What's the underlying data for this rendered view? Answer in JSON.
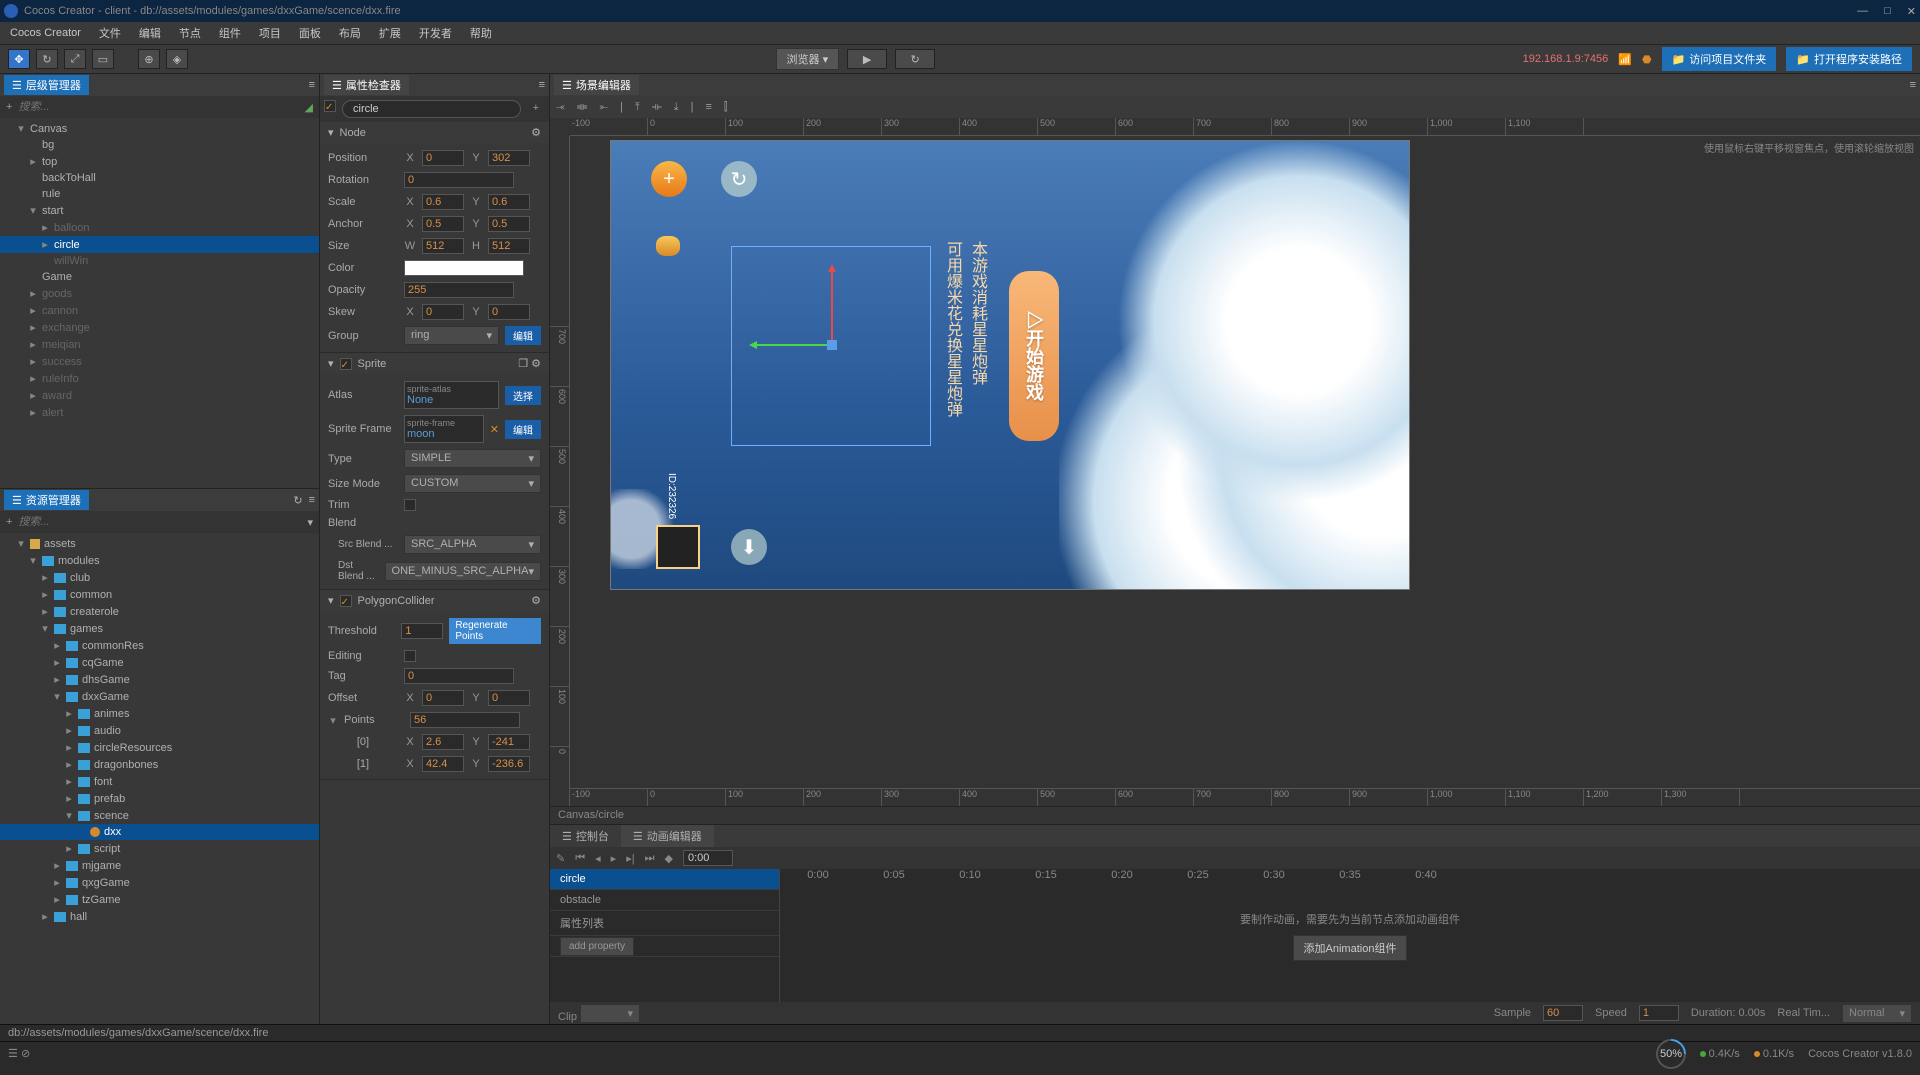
{
  "window": {
    "title": "Cocos Creator - client - db://assets/modules/games/dxxGame/scence/dxx.fire",
    "minimize": "—",
    "maximize": "□",
    "close": "✕"
  },
  "menu": [
    "Cocos Creator",
    "文件",
    "编辑",
    "节点",
    "组件",
    "项目",
    "面板",
    "布局",
    "扩展",
    "开发者",
    "帮助"
  ],
  "toolbar": {
    "browser": "浏览器 ▾",
    "ip": "192.168.1.9:7456",
    "visit": "访问项目文件夹",
    "open": "打开程序安装路径"
  },
  "panels": {
    "hierarchy": "层级管理器",
    "assets": "资源管理器",
    "inspector": "属性检查器",
    "scene": "场景编辑器",
    "console": "控制台",
    "animation": "动画编辑器"
  },
  "search_placeholder": "搜索...",
  "hierarchy_tree": {
    "root": "Canvas",
    "items": [
      "bg",
      "top",
      "backToHall",
      "rule",
      "start",
      "balloon",
      "circle",
      "willWin",
      "Game",
      "goods",
      "cannon",
      "exchange",
      "meiqian",
      "success",
      "ruleInfo",
      "award",
      "alert"
    ]
  },
  "assets_tree": {
    "root": "assets",
    "modules": "modules",
    "subs": [
      "club",
      "common",
      "createrole",
      "games"
    ],
    "games": [
      "commonRes",
      "cqGame",
      "dhsGame",
      "dxxGame"
    ],
    "dxx": [
      "animes",
      "audio",
      "circleResources",
      "dragonbones",
      "font",
      "prefab",
      "scence",
      "script"
    ],
    "fire": "dxx",
    "more": [
      "mjgame",
      "qxgGame",
      "tzGame",
      "hall"
    ]
  },
  "inspector": {
    "node_name": "circle",
    "sections": {
      "node": "Node",
      "sprite": "Sprite",
      "polygon": "PolygonCollider",
      "points": "Points"
    },
    "labels": {
      "position": "Position",
      "rotation": "Rotation",
      "scale": "Scale",
      "anchor": "Anchor",
      "size": "Size",
      "color": "Color",
      "opacity": "Opacity",
      "skew": "Skew",
      "group": "Group",
      "atlas": "Atlas",
      "sprite_frame": "Sprite Frame",
      "type": "Type",
      "size_mode": "Size Mode",
      "trim": "Trim",
      "blend": "Blend",
      "src_blend": "Src Blend ...",
      "dst_blend": "Dst Blend ...",
      "threshold": "Threshold",
      "editing": "Editing",
      "tag": "Tag",
      "offset": "Offset"
    },
    "values": {
      "pos_x": "0",
      "pos_y": "302",
      "rotation": "0",
      "scale_x": "0.6",
      "scale_y": "0.6",
      "anchor_x": "0.5",
      "anchor_y": "0.5",
      "size_w": "512",
      "size_h": "512",
      "opacity": "255",
      "skew_x": "0",
      "skew_y": "0",
      "group": "ring",
      "atlas_head": "sprite-atlas",
      "atlas": "None",
      "frame_head": "sprite-frame",
      "frame": "moon",
      "type": "SIMPLE",
      "size_mode": "CUSTOM",
      "src_blend": "SRC_ALPHA",
      "dst_blend": "ONE_MINUS_SRC_ALPHA",
      "threshold": "1",
      "tag": "0",
      "offset_x": "0",
      "offset_y": "0",
      "points_count": "56",
      "p0x": "2.6",
      "p0y": "-241",
      "p1x": "42.4",
      "p1y": "-236.6",
      "p0_label": "[0]",
      "p1_label": "[1]"
    },
    "buttons": {
      "edit": "编辑",
      "select": "选择",
      "regen": "Regenerate Points"
    }
  },
  "scene": {
    "hint": "使用鼠标右键平移视窗焦点，使用滚轮缩放视图",
    "path": "Canvas/circle",
    "ruler_h": [
      "-100",
      "0",
      "100",
      "200",
      "300",
      "400",
      "500",
      "600",
      "700",
      "800",
      "900",
      "1,000",
      "1,100",
      "1,200",
      "1,300"
    ],
    "ruler_v": [
      "0",
      "100",
      "200",
      "300",
      "400",
      "500",
      "600",
      "700"
    ],
    "game": {
      "start_btn": "▷开始游戏",
      "text1": "本游戏消耗星星炮弹",
      "text2": "可用爆米花兑换星星炮弹",
      "id": "ID:232326"
    }
  },
  "timeline": {
    "time_field": "0:00",
    "marks": [
      "0:00",
      "0:05",
      "0:10",
      "0:15",
      "0:20",
      "0:25",
      "0:30",
      "0:35",
      "0:40"
    ],
    "items": [
      "circle",
      "obstacle"
    ],
    "prop_list": "属性列表",
    "add_prop": "add property",
    "msg": "要制作动画，需要先为当前节点添加动画组件",
    "add_comp": "添加Animation组件",
    "footer": {
      "clip": "Clip",
      "sample": "Sample",
      "sample_v": "60",
      "speed": "Speed",
      "speed_v": "1",
      "duration": "Duration: 0.00s",
      "realtime": "Real Tim...",
      "mode": "Normal"
    }
  },
  "status": {
    "path": "db://assets/modules/games/dxxGame/scence/dxx.fire",
    "zoom": "50%",
    "net1": "0.4K/s",
    "net2": "0.1K/s",
    "version": "Cocos Creator v1.8.0"
  }
}
